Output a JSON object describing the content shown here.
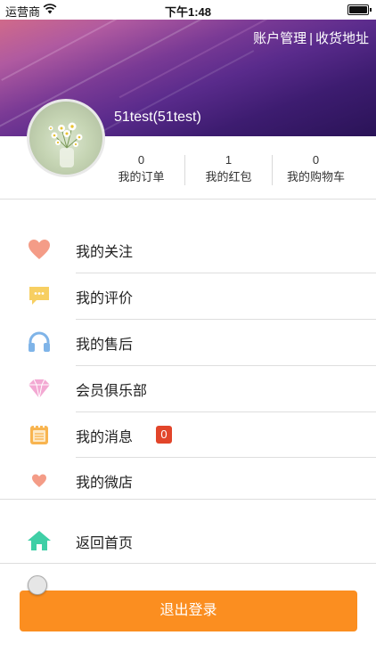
{
  "status_bar": {
    "carrier": "运营商",
    "time": "下午1:48"
  },
  "header": {
    "account_link": "账户管理",
    "separator": "|",
    "address_link": "收货地址",
    "username": "51test(51test)"
  },
  "stats": [
    {
      "count": "0",
      "label": "我的订单"
    },
    {
      "count": "1",
      "label": "我的红包"
    },
    {
      "count": "0",
      "label": "我的购物车"
    }
  ],
  "menu": [
    {
      "label": "我的关注",
      "icon": "heart-icon"
    },
    {
      "label": "我的评价",
      "icon": "comment-icon"
    },
    {
      "label": "我的售后",
      "icon": "headphones-icon"
    },
    {
      "label": "会员俱乐部",
      "icon": "diamond-icon"
    },
    {
      "label": "我的消息",
      "icon": "notepad-icon",
      "badge": "0"
    },
    {
      "label": "我的微店",
      "icon": "small-heart-icon"
    },
    {
      "label": "返回首页",
      "icon": "home-icon"
    }
  ],
  "logout_label": "退出登录",
  "colors": {
    "accent": "#fb8e20",
    "badge": "#e2452a",
    "heart": "#f08a7e",
    "home": "#3fcfa6"
  }
}
